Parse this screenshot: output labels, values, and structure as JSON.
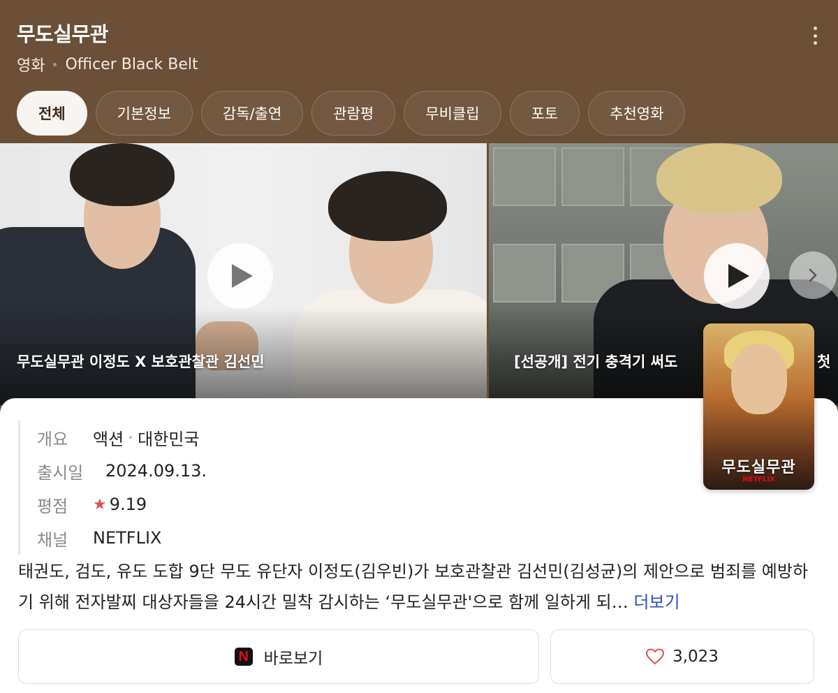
{
  "header": {
    "title": "무도실무관",
    "category": "영화",
    "english_title": "Officer Black Belt",
    "more_icon": "kebab-menu-icon",
    "bg_color": "#6b4f36"
  },
  "tabs": [
    {
      "label": "전체",
      "active": true
    },
    {
      "label": "기본정보"
    },
    {
      "label": "감독/출연"
    },
    {
      "label": "관람평"
    },
    {
      "label": "무비클립"
    },
    {
      "label": "포토"
    },
    {
      "label": "추천영화"
    }
  ],
  "videos": [
    {
      "caption": "무도실무관 이정도 X 보호관찰관 김선민",
      "icon": "play-icon"
    },
    {
      "caption": "[선공개] 전기 충격기 써도",
      "caption_tail": "첫",
      "icon": "play-icon"
    }
  ],
  "carousel": {
    "next_icon": "chevron-right-icon"
  },
  "poster": {
    "title": "무도실무관",
    "brand": "NETFLIX"
  },
  "info": {
    "overview_label": "개요",
    "genre": "액션",
    "country": "대한민국",
    "release_label": "출시일",
    "release_date": "2024.09.13.",
    "rating_label": "평점",
    "rating": "9.19",
    "channel_label": "채널",
    "channel": "NETFLIX"
  },
  "description": {
    "text": "태권도, 검도, 유도 도합 9단 무도 유단자 이정도(김우빈)가 보호관찰관 김선민(김성균)의 제안으로 범죄를 예방하기 위해 전자발찌 대상자들을 24시간 밀착 감시하는 ‘무도실무관'으로 함께 일하게 되…",
    "more_label": "더보기"
  },
  "actions": {
    "watch_label": "바로보기",
    "like_count": "3,023"
  },
  "colors": {
    "accent_link": "#2a4fbf",
    "star": "#e0524a",
    "netflix_red": "#e50914"
  }
}
